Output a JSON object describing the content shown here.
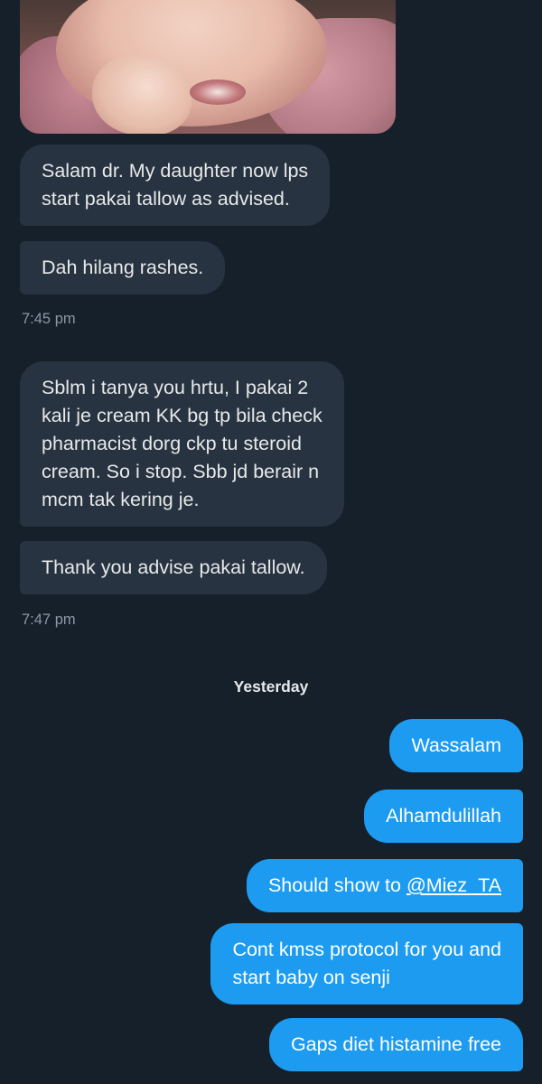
{
  "conversation": {
    "received_block_1": {
      "messages": [
        "Salam dr. My daughter now lps\nstart pakai tallow as advised.",
        "Dah hilang rashes."
      ],
      "time": "7:45 pm"
    },
    "received_block_2": {
      "messages": [
        "Sblm i tanya you hrtu, I pakai 2\nkali je cream KK bg tp bila check\npharmacist dorg ckp tu steroid\ncream. So i stop. Sbb jd berair n\nmcm tak kering je.",
        "Thank you advise pakai tallow."
      ],
      "time": "7:47 pm"
    },
    "day_divider": "Yesterday",
    "sent_messages": {
      "m1": "Wassalam",
      "m2": "Alhamdulillah",
      "m3_prefix": "Should show to ",
      "m3_mention": "@Miez_TA",
      "m4": "Cont kmss protocol for you and\nstart baby on senji",
      "m5": "Gaps diet histamine free"
    }
  },
  "colors": {
    "background": "#15202b",
    "received_bubble": "#273340",
    "sent_bubble": "#1d9bf0",
    "timestamp": "#8b98a5"
  }
}
